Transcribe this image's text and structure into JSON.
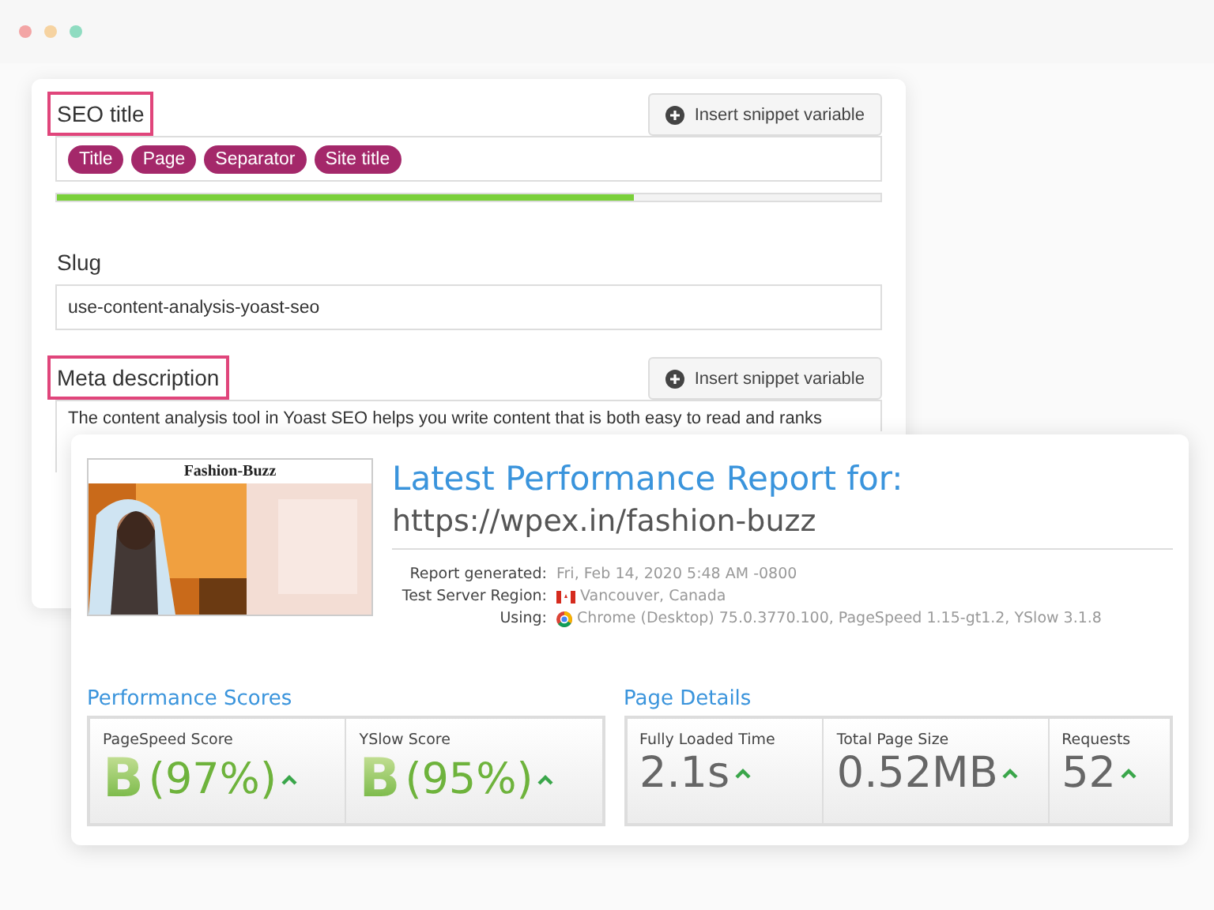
{
  "seo_form": {
    "seo_title": {
      "label": "SEO title",
      "button": "Insert snippet variable",
      "chips": [
        "Title",
        "Page",
        "Separator",
        "Site title"
      ],
      "level": 0.7
    },
    "slug": {
      "label": "Slug",
      "value": "use-content-analysis-yoast-seo"
    },
    "meta_description": {
      "label": "Meta description",
      "button": "Insert snippet variable",
      "value": "The content analysis tool in Yoast SEO helps you write content that is both easy to read and ranks"
    }
  },
  "report": {
    "thumbnail": {
      "site_name": "Fashion-Buzz"
    },
    "title": "Latest Performance Report for:",
    "url": "https://wpex.in/fashion-buzz",
    "info": [
      {
        "label": "Report generated:",
        "value": "Fri, Feb 14, 2020 5:48 AM -0800"
      },
      {
        "label": "Test Server Region:",
        "value": "Vancouver, Canada"
      },
      {
        "label": "Using:",
        "value": "Chrome (Desktop) 75.0.3770.100, PageSpeed 1.15-gt1.2, YSlow 3.1.8"
      }
    ],
    "performance": {
      "heading": "Performance Scores",
      "scores": [
        {
          "label": "PageSpeed Score",
          "grade": "B",
          "percent": "(97%)"
        },
        {
          "label": "YSlow Score",
          "grade": "B",
          "percent": "(95%)"
        }
      ]
    },
    "details": {
      "heading": "Page Details",
      "items": [
        {
          "label": "Fully Loaded Time",
          "value": "2.1s"
        },
        {
          "label": "Total Page Size",
          "value": "0.52MB"
        },
        {
          "label": "Requests",
          "value": "52"
        }
      ]
    }
  }
}
